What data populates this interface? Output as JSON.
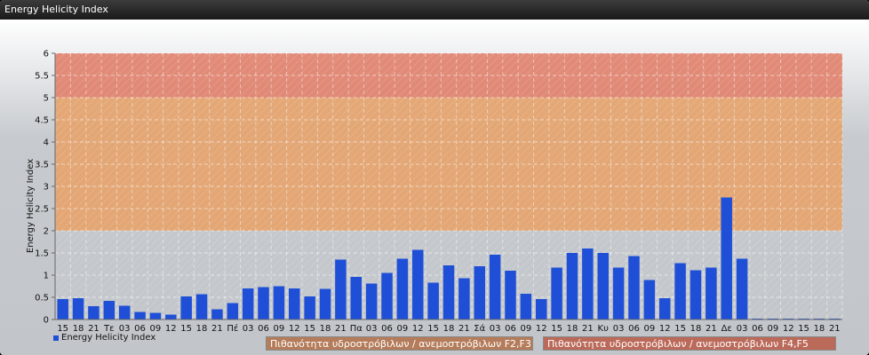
{
  "window": {
    "title": "Energy Helicity Index"
  },
  "legend": {
    "series_label": "Energy Helicity Index"
  },
  "bands": [
    {
      "label": "Πιθανότητα υδροστρόβιλων / ανεμοστρόβιλων F2,F3",
      "from": 2,
      "to": 5,
      "color": "#e6a26a"
    },
    {
      "label": "Πιθανότητα υδροστρόβιλων / ανεμοστρόβιλων F4,F5",
      "from": 5,
      "to": 6,
      "color": "#e0806a"
    }
  ],
  "chart_data": {
    "type": "bar",
    "ylabel": "Energy Helicity Index",
    "ylim": [
      0,
      6
    ],
    "yticks": [
      0,
      0.5,
      1,
      1.5,
      2,
      2.5,
      3,
      3.5,
      4,
      4.5,
      5,
      5.5,
      6
    ],
    "grid": true,
    "legend_position": "bottom-left",
    "bar_color": "#1f4fd6",
    "categories": [
      "15",
      "18",
      "21",
      "Τε",
      "03",
      "06",
      "09",
      "12",
      "15",
      "18",
      "21",
      "Πέ",
      "03",
      "06",
      "09",
      "12",
      "15",
      "18",
      "21",
      "Πα",
      "03",
      "06",
      "09",
      "12",
      "15",
      "18",
      "21",
      "Σά",
      "03",
      "06",
      "09",
      "12",
      "15",
      "18",
      "21",
      "Κυ",
      "03",
      "06",
      "09",
      "12",
      "15",
      "18",
      "21",
      "Δε",
      "03",
      "06",
      "09",
      "12",
      "15",
      "18",
      "21"
    ],
    "values": [
      0.46,
      0.48,
      0.3,
      0.42,
      0.31,
      0.17,
      0.15,
      0.11,
      0.52,
      0.57,
      0.23,
      0.37,
      0.7,
      0.73,
      0.75,
      0.7,
      0.52,
      0.69,
      1.35,
      0.96,
      0.81,
      1.05,
      1.37,
      1.57,
      0.83,
      1.22,
      0.93,
      1.2,
      1.46,
      1.1,
      0.58,
      0.46,
      1.17,
      1.5,
      1.6,
      1.5,
      1.17,
      1.43,
      0.89,
      0.48,
      1.27,
      1.11,
      1.17,
      2.75,
      1.37,
      0.02,
      0.02,
      0.02,
      0.02,
      0.02,
      0.02
    ]
  }
}
